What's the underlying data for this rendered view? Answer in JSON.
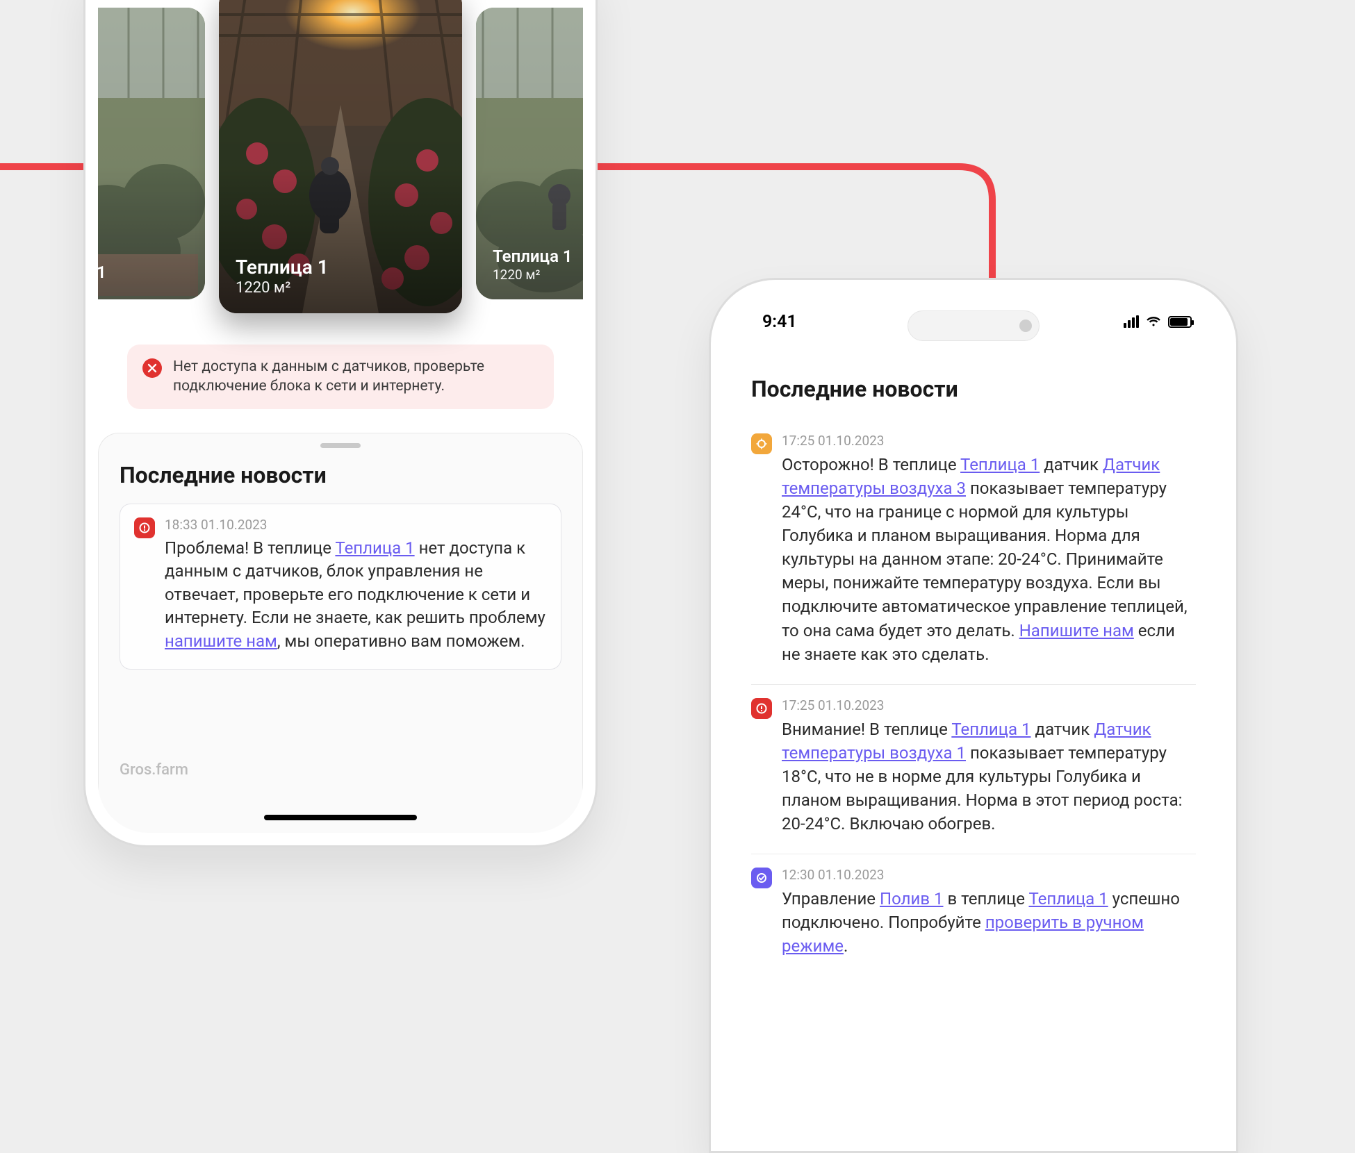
{
  "status": {
    "time": "9:41"
  },
  "cards": {
    "left": {
      "title": "1",
      "sub": ""
    },
    "center": {
      "title": "Теплица 1",
      "sub": "1220 м²"
    },
    "right": {
      "title": "Теплица 1",
      "sub": "1220 м²"
    }
  },
  "alert": {
    "text": "Нет доступа к данным с датчиков, проверьте подключение блока к сети и интернету."
  },
  "news_heading": "Последние новости",
  "brand": "Gros.farm",
  "left_news": {
    "time": "18:33 01.10.2023",
    "t1": "Проблема! В теплице ",
    "link1": "Теплица 1",
    "t2": " нет доступа к данным с датчиков, блок управления не отвечает, проверьте его подключение к сети и интернету. Если не знаете, как решить проблему ",
    "link2": "напишите нам",
    "t3": ", мы оперативно вам поможем."
  },
  "right_news": [
    {
      "icon": "orange",
      "time": "17:25 01.10.2023",
      "parts": [
        {
          "t": "Осторожно! В теплице "
        },
        {
          "l": "Теплица 1"
        },
        {
          "t": " датчик "
        },
        {
          "l": "Датчик температуры воздуха 3"
        },
        {
          "t": " показывает температуру 24°C, что на границе с нормой для культуры Голубика и планом выращивания. Норма для культуры на данном этапе: 20-24°C. Принимайте меры, понижайте температуру воздуха. Если вы подключите автоматическое управление теплицей, то она сама будет это делать. "
        },
        {
          "l": "Напишите нам"
        },
        {
          "t": "  если не знаете как это сделать."
        }
      ]
    },
    {
      "icon": "red",
      "time": "17:25 01.10.2023",
      "parts": [
        {
          "t": "Внимание! В теплице "
        },
        {
          "l": "Теплица 1"
        },
        {
          "t": " датчик "
        },
        {
          "l": "Датчик температуры воздуха 1"
        },
        {
          "t": " показывает температуру 18°C, что не в норме для культуры Голубика и планом выращивания. Норма в этот период роста: 20-24°C. Включаю обогрев."
        }
      ]
    },
    {
      "icon": "violet",
      "time": "12:30 01.10.2023",
      "parts": [
        {
          "t": "Управление "
        },
        {
          "l": "Полив 1"
        },
        {
          "t": " в теплице "
        },
        {
          "l": "Теплица 1"
        },
        {
          "t": " успешно подключено. Попробуйте "
        },
        {
          "l": "проверить в ручном режиме"
        },
        {
          "t": "."
        }
      ]
    }
  ]
}
